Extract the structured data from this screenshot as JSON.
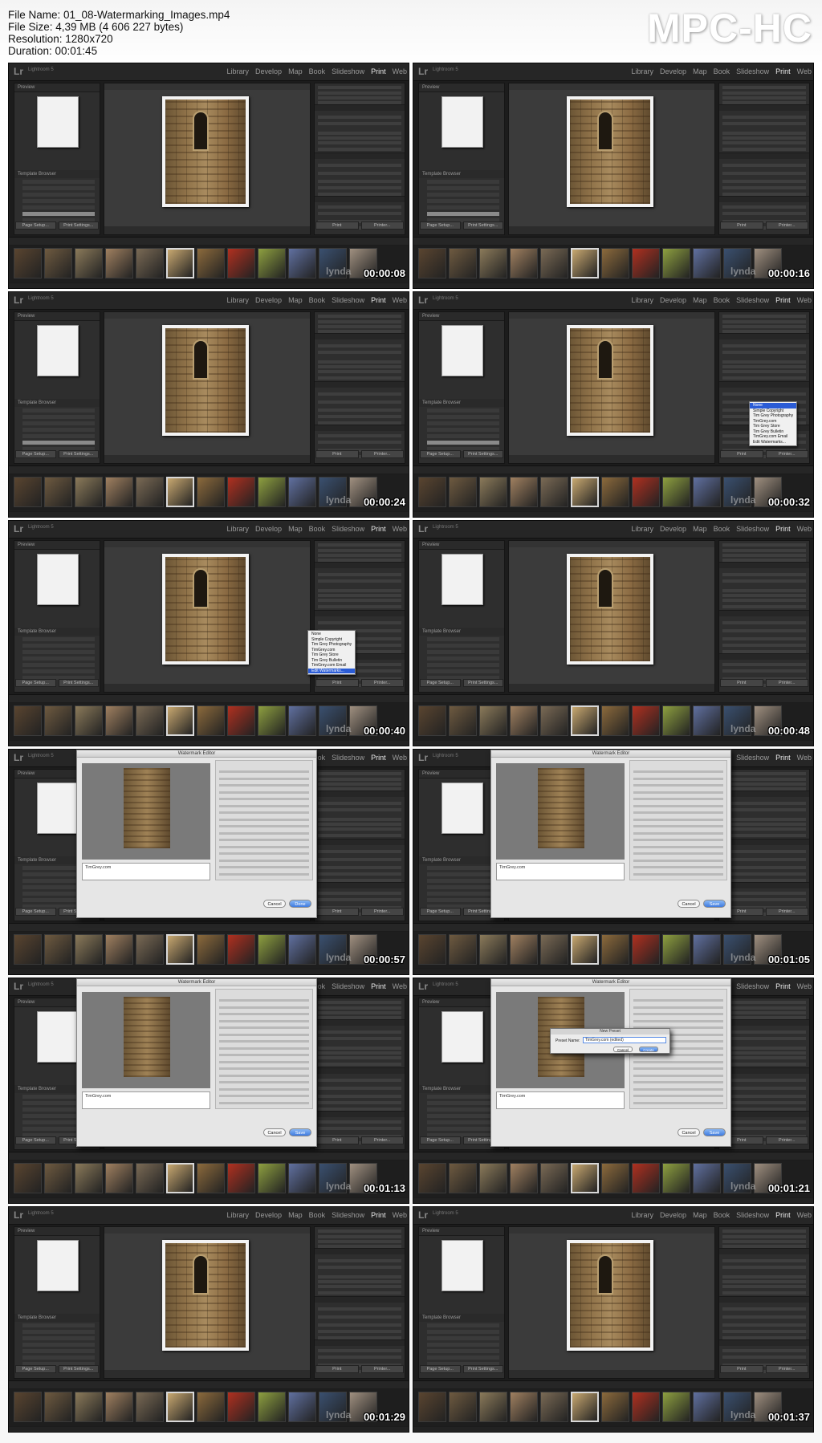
{
  "file_info": {
    "file_name": "File Name: 01_08-Watermarking_Images.mp4",
    "file_size": "File Size: 4,39 MB (4 606 227 bytes)",
    "resolution": "Resolution: 1280x720",
    "duration": "Duration: 00:01:45"
  },
  "brand": "MPC-HC",
  "app": {
    "logo": "Lr",
    "subtitle": "Lightroom 5",
    "modules": [
      "Library",
      "Develop",
      "Map",
      "Book",
      "Slideshow",
      "Print",
      "Web"
    ],
    "active_module": "Print",
    "left_panel_header": "Preview",
    "template_browser": "Template Browser",
    "page_setup": "Page Setup...",
    "print_settings": "Print Settings...",
    "print": "Print",
    "printer": "Printer...",
    "watermark_label": "lynda"
  },
  "colors": {
    "lr_background": "#1c1c1c",
    "panel": "#2e2e2e",
    "highlight_blue": "#2b5cd6"
  },
  "thumbnails": [
    {
      "timestamp": "00:00:08",
      "state": "layout"
    },
    {
      "timestamp": "00:00:16",
      "state": "layout"
    },
    {
      "timestamp": "00:00:24",
      "state": "page"
    },
    {
      "timestamp": "00:00:32",
      "state": "menu"
    },
    {
      "timestamp": "00:00:40",
      "state": "menu-hl"
    },
    {
      "timestamp": "00:00:48",
      "state": "page"
    },
    {
      "timestamp": "00:00:57",
      "state": "editor"
    },
    {
      "timestamp": "00:01:05",
      "state": "editor"
    },
    {
      "timestamp": "00:01:13",
      "state": "editor"
    },
    {
      "timestamp": "00:01:21",
      "state": "editor-preset"
    },
    {
      "timestamp": "00:01:29",
      "state": "page"
    },
    {
      "timestamp": "00:01:37",
      "state": "page"
    }
  ],
  "watermark_menu": {
    "items": [
      "None",
      "Simple Copyright",
      "Tim Grey Photography",
      "TimGrey.com",
      "Tim Grey Store",
      "Tim Grey Bulletin",
      "TimGrey.com Email",
      "Edit Watermarks..."
    ]
  },
  "watermark_editor": {
    "title": "Watermark Editor",
    "style_label": "Watermark Style:",
    "text_option": "Text",
    "graphic_option": "Graphic",
    "text_value": "TimGrey.com",
    "cancel": "Cancel",
    "save": "Save",
    "done": "Done"
  },
  "new_preset": {
    "title": "New Preset",
    "label": "Preset Name:",
    "value": "TimGrey.com (edited)",
    "cancel": "Cancel",
    "create": "Create"
  }
}
